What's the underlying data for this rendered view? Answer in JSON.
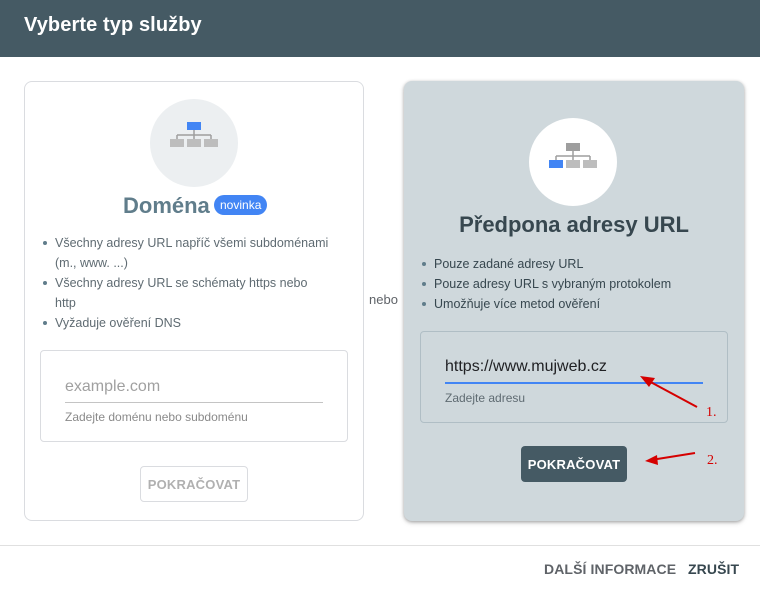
{
  "header": {
    "title": "Vyberte typ služby"
  },
  "domain_card": {
    "title": "Doména",
    "badge": "novinka",
    "features": [
      "Všechny adresy URL napříč všemi subdoménami (m., www. ...)",
      "Všechny adresy URL se schématy https nebo http",
      "Vyžaduje ověření DNS"
    ],
    "input": {
      "placeholder": "example.com",
      "value": "",
      "hint": "Zadejte doménu nebo subdoménu"
    },
    "button": "POKRAČOVAT",
    "icon": "sitemap-icon"
  },
  "separator": "nebo",
  "url_card": {
    "title": "Předpona adresy URL",
    "features": [
      "Pouze zadané adresy URL",
      "Pouze adresy URL s vybraným protokolem",
      "Umožňuje více metod ověření"
    ],
    "input": {
      "value": "https://www.mujweb.cz",
      "hint": "Zadejte adresu"
    },
    "button": "POKRAČOVAT",
    "icon": "sitemap-icon"
  },
  "annotations": {
    "step1": "1.",
    "step2": "2."
  },
  "footer": {
    "more_info": "DALŠÍ INFORMACE",
    "cancel": "ZRUŠIT"
  },
  "colors": {
    "header_bg": "#455a64",
    "accent_blue": "#4285f4",
    "selected_card_bg": "#cfd8dc",
    "annotation_red": "#d50000"
  }
}
